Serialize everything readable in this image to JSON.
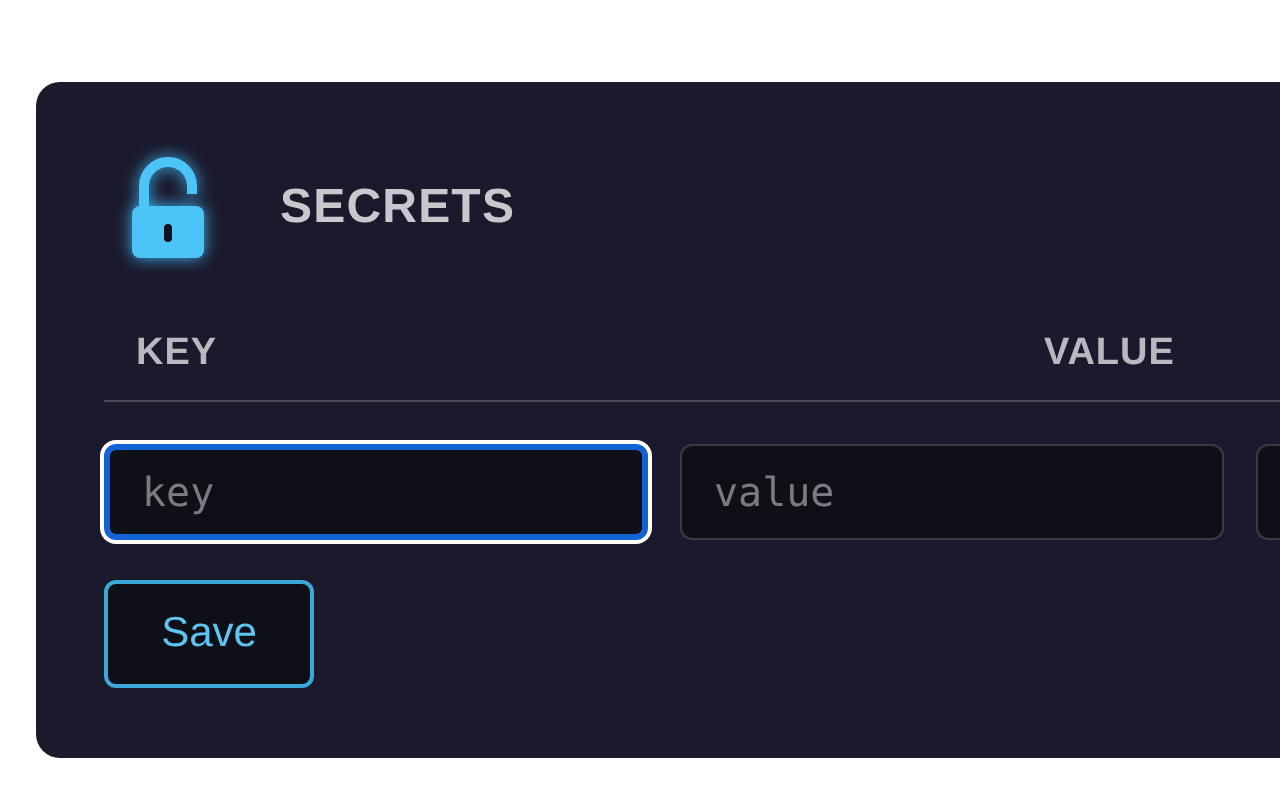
{
  "panel": {
    "title": "SECRETS",
    "locked": false
  },
  "columns": [
    "KEY",
    "VALUE"
  ],
  "fields": [
    {
      "placeholder": "key",
      "focused": true
    },
    {
      "placeholder": "value",
      "focused": false
    },
    {
      "focused": false
    }
  ],
  "buttons": [
    "Save"
  ]
}
